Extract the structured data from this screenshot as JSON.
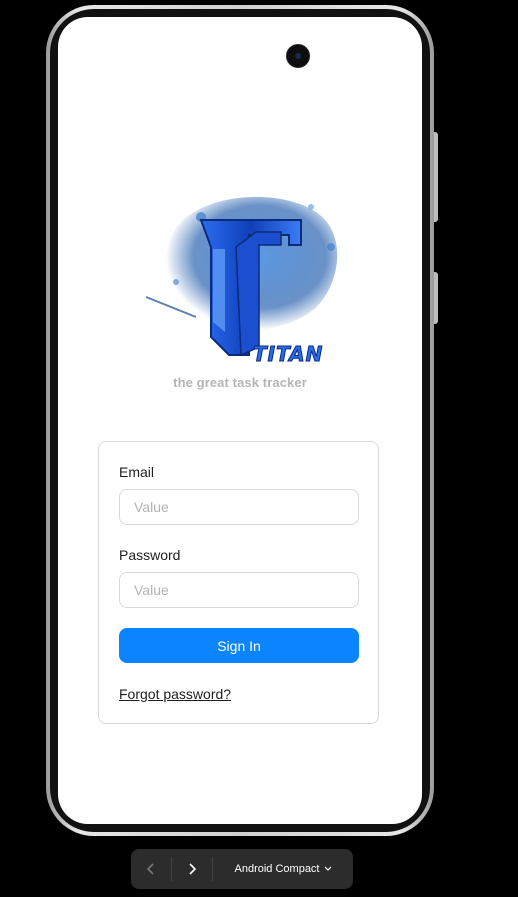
{
  "app": {
    "tagline": "the great task tracker",
    "logo_text": "TITAN"
  },
  "login": {
    "email_label": "Email",
    "email_placeholder": "Value",
    "email_value": "",
    "password_label": "Password",
    "password_placeholder": "Value",
    "password_value": "",
    "sign_in_label": "Sign In",
    "forgot_label": "Forgot password?"
  },
  "toolbar": {
    "device_name": "Android Compact",
    "back_icon": "chevron-left-icon",
    "forward_icon": "chevron-right-icon",
    "dropdown_icon": "chevron-down-icon"
  },
  "colors": {
    "accent": "#0a84ff",
    "tagline": "#b5b5b5",
    "logo_blue": "#1e5bd6"
  }
}
